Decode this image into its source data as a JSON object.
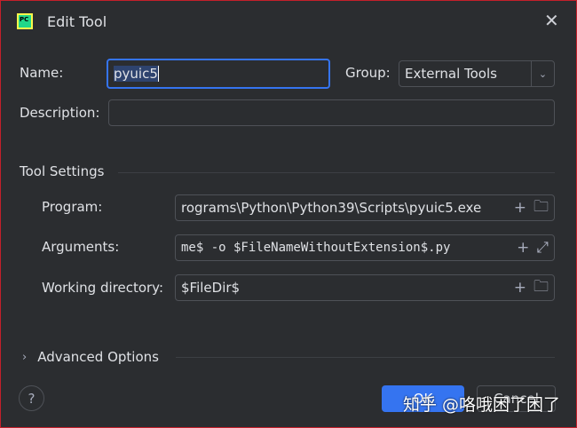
{
  "window": {
    "title": "Edit Tool"
  },
  "form": {
    "name_label": "Name:",
    "name_value": "pyuic5",
    "group_label": "Group:",
    "group_value": "External Tools",
    "description_label": "Description:",
    "description_value": ""
  },
  "tool_settings": {
    "title": "Tool Settings",
    "program_label": "Program:",
    "program_value": "rograms\\Python\\Python39\\Scripts\\pyuic5.exe",
    "arguments_label": "Arguments:",
    "arguments_value": "me$ -o $FileNameWithoutExtension$.py",
    "workdir_label": "Working directory:",
    "workdir_value": "$FileDir$"
  },
  "advanced": {
    "label": "Advanced Options"
  },
  "buttons": {
    "ok": "OK",
    "cancel": "Cancel",
    "help": "?"
  },
  "watermark": "知乎 @咯哦困了困了"
}
